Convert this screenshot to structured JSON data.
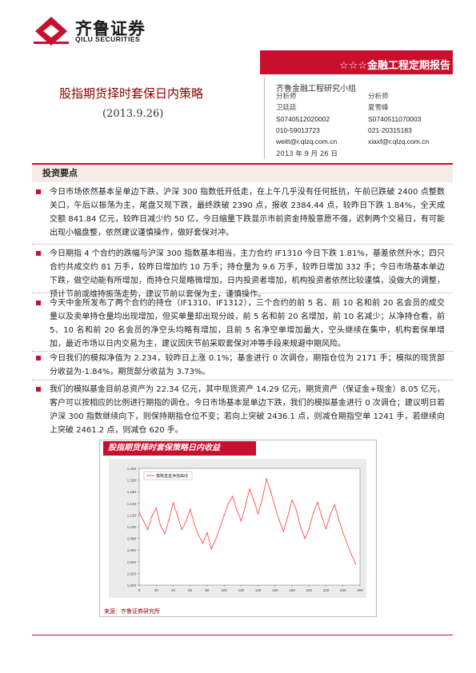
{
  "header": {
    "brand_cn": "齐鲁证券",
    "brand_en": "QILU SECURITIES",
    "banner": "☆☆☆金融工程定期报告"
  },
  "report": {
    "title": "股指期货择时套保日内策略",
    "date": "(2013.9.26)"
  },
  "team": {
    "name": "齐鲁金融工程研究小组",
    "analysts": [
      {
        "role": "分析师",
        "name": "卫廷廷",
        "license": "S0740512020002",
        "phone": "010-59013723",
        "email": "weitt@r.qlzq.com.cn"
      },
      {
        "role": "分析师",
        "name": "夏雪峰",
        "license": "S0740511070003",
        "phone": "021-20315183",
        "email": "xiaxf@r.qlzq.com.cn"
      }
    ],
    "report_date": "2013 年 9 月 26 日"
  },
  "section_title": "投资要点",
  "points": [
    "今日市场依然基本呈单边下跌，沪深 300 指数低开低走，在上午几乎没有任何抵抗，午前已跌破 2400 点整数关口，午后以振荡为主，尾盘又现下跌，最终跌破 2390 点，报收 2384.44 点，较昨日下跌 1.84%，全天成交额 841.84 亿元，较昨日减少约 50 亿，今日缩量下跌显示市前资金持股意愿不强，迟刺两个交易日，有可能出现小幅盘整，依然建议谨慎操作，做好套保对冲。",
    "今日期指 4 个合约的跌幅与沪深 300 指数基本相当，主力合约 IF1310 今日下跌 1.81%，基差依然升水；四只合约共成交约 81 万手，较昨日增加约 10 万手；持仓量为 9.6 万手，较昨日增加 332 手；今日市场基本单边下跌，做空动能有所增加，而持仓只是略微增加，日内投资者增加，机构投资者依然比较谨慎，没做大的调整，预计节前或维持振荡走势，建议节前以套保为主，谨慎操作。",
    "今天中金所发布了两个合约的持仓（IF1310、IF1312），三个合约的前 5 名、前 10 名和前 20 名会员的成交量以及卖单持仓量均出现增加，但买单量却出现分歧，前 5 名和前 20 名增加，前 10 名减少；从净持仓看，前 5、10 名和前 20 名会员的净空头均略有增加，且前 5 名净空单增加最大，空头继续在集中，机构套保单增加，最近市场以日内交易为主，建议因庆节前采取套保对冲等手段来规避中期风险。",
    "今日我们的模拟净值为 2.234，较昨日上涨 0.1%；基金进行 0 次调仓，期指仓位为 2171 手；模拟的现货部分收益为-1.84%，期货部分收益为 3.73%。",
    "我们的模拟基金目前总资产为 22.34 亿元，其中现货资产 14.29 亿元，期货资产（保证金+现金）8.05 亿元，客户可以按相应的比例进行期指的调仓。今日市场基本是单边下跌，我们的模拟基金进行 0 次调仓；建议明日若沪深 300 指数继续向下，则保持期指仓位不变；若向上突破 2436.1 点，则减仓期指空单 1241 手，若继续向上突破 2461.2 点，则减仓 620 手。"
  ],
  "figure": {
    "title": "股指期货择时套保策略日内收益",
    "source": "来源：齐鲁证券研究所"
  },
  "chart_data": {
    "type": "line",
    "title": "",
    "legend": [
      "策略基金净值曲线"
    ],
    "legend_position": "top-left",
    "xlim": [
      0,
      260
    ],
    "ylim": [
      1.0,
      1.2
    ],
    "x_ticks": [
      "0",
      "20",
      "40",
      "60",
      "80",
      "100",
      "120",
      "140",
      "160",
      "180",
      "200",
      "220",
      "240",
      "260"
    ],
    "y_ticks": [
      "1.200",
      "1.180",
      "1.160",
      "1.140",
      "1.120",
      "1.100",
      "1.080",
      "1.060",
      "1.040",
      "1.020",
      "1.000"
    ],
    "line_color": "#ff3b3b",
    "series": [
      {
        "name": "策略基金净值曲线",
        "x": [
          0,
          5,
          10,
          15,
          20,
          25,
          30,
          35,
          40,
          45,
          50,
          55,
          60,
          65,
          70,
          75,
          80,
          85,
          90,
          95,
          100,
          105,
          110,
          115,
          120,
          125,
          130,
          135,
          140,
          145,
          150,
          155,
          160,
          165,
          170,
          175,
          180,
          185,
          190,
          195,
          200,
          205,
          210,
          215,
          220,
          225,
          230,
          235,
          240,
          245,
          250,
          255
        ],
        "values": [
          1.125,
          1.11,
          1.095,
          1.118,
          1.132,
          1.102,
          1.088,
          1.112,
          1.141,
          1.12,
          1.095,
          1.108,
          1.13,
          1.104,
          1.085,
          1.072,
          1.09,
          1.062,
          1.078,
          1.098,
          1.12,
          1.14,
          1.152,
          1.128,
          1.11,
          1.135,
          1.165,
          1.145,
          1.122,
          1.148,
          1.182,
          1.16,
          1.134,
          1.11,
          1.092,
          1.118,
          1.146,
          1.128,
          1.1,
          1.08,
          1.096,
          1.124,
          1.142,
          1.118,
          1.096,
          1.12,
          1.138,
          1.112,
          1.09,
          1.07,
          1.052,
          1.036
        ]
      }
    ]
  }
}
